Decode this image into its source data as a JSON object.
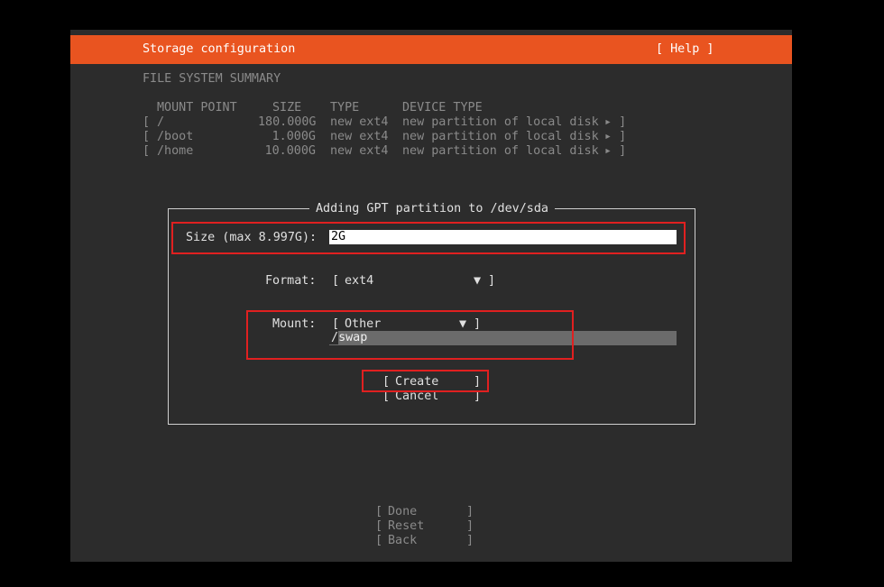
{
  "header": {
    "title": "Storage configuration",
    "help_label": "[ Help ]"
  },
  "summary": {
    "heading": "FILE SYSTEM SUMMARY",
    "columns": [
      "MOUNT POINT",
      "SIZE",
      "TYPE",
      "DEVICE TYPE"
    ],
    "rows": [
      {
        "mount": "/",
        "size": "180.000G",
        "type": "new ext4",
        "device": "new partition of local disk"
      },
      {
        "mount": "/boot",
        "size": "1.000G",
        "type": "new ext4",
        "device": "new partition of local disk"
      },
      {
        "mount": "/home",
        "size": "10.000G",
        "type": "new ext4",
        "device": "new partition of local disk"
      }
    ]
  },
  "dialog": {
    "title": "Adding GPT partition to /dev/sda",
    "size_label": "Size (max 8.997G):",
    "size_value": "2G",
    "format_label": "Format:",
    "format_value": "ext4",
    "mount_label": "Mount:",
    "mount_value": "Other",
    "mount_custom_slash": "/",
    "mount_custom_value": "swap",
    "create_label": "Create",
    "cancel_label": "Cancel"
  },
  "footer": {
    "done_label": "Done",
    "reset_label": "Reset",
    "back_label": "Back"
  },
  "colors": {
    "accent": "#e95420",
    "highlight": "#e02020"
  }
}
